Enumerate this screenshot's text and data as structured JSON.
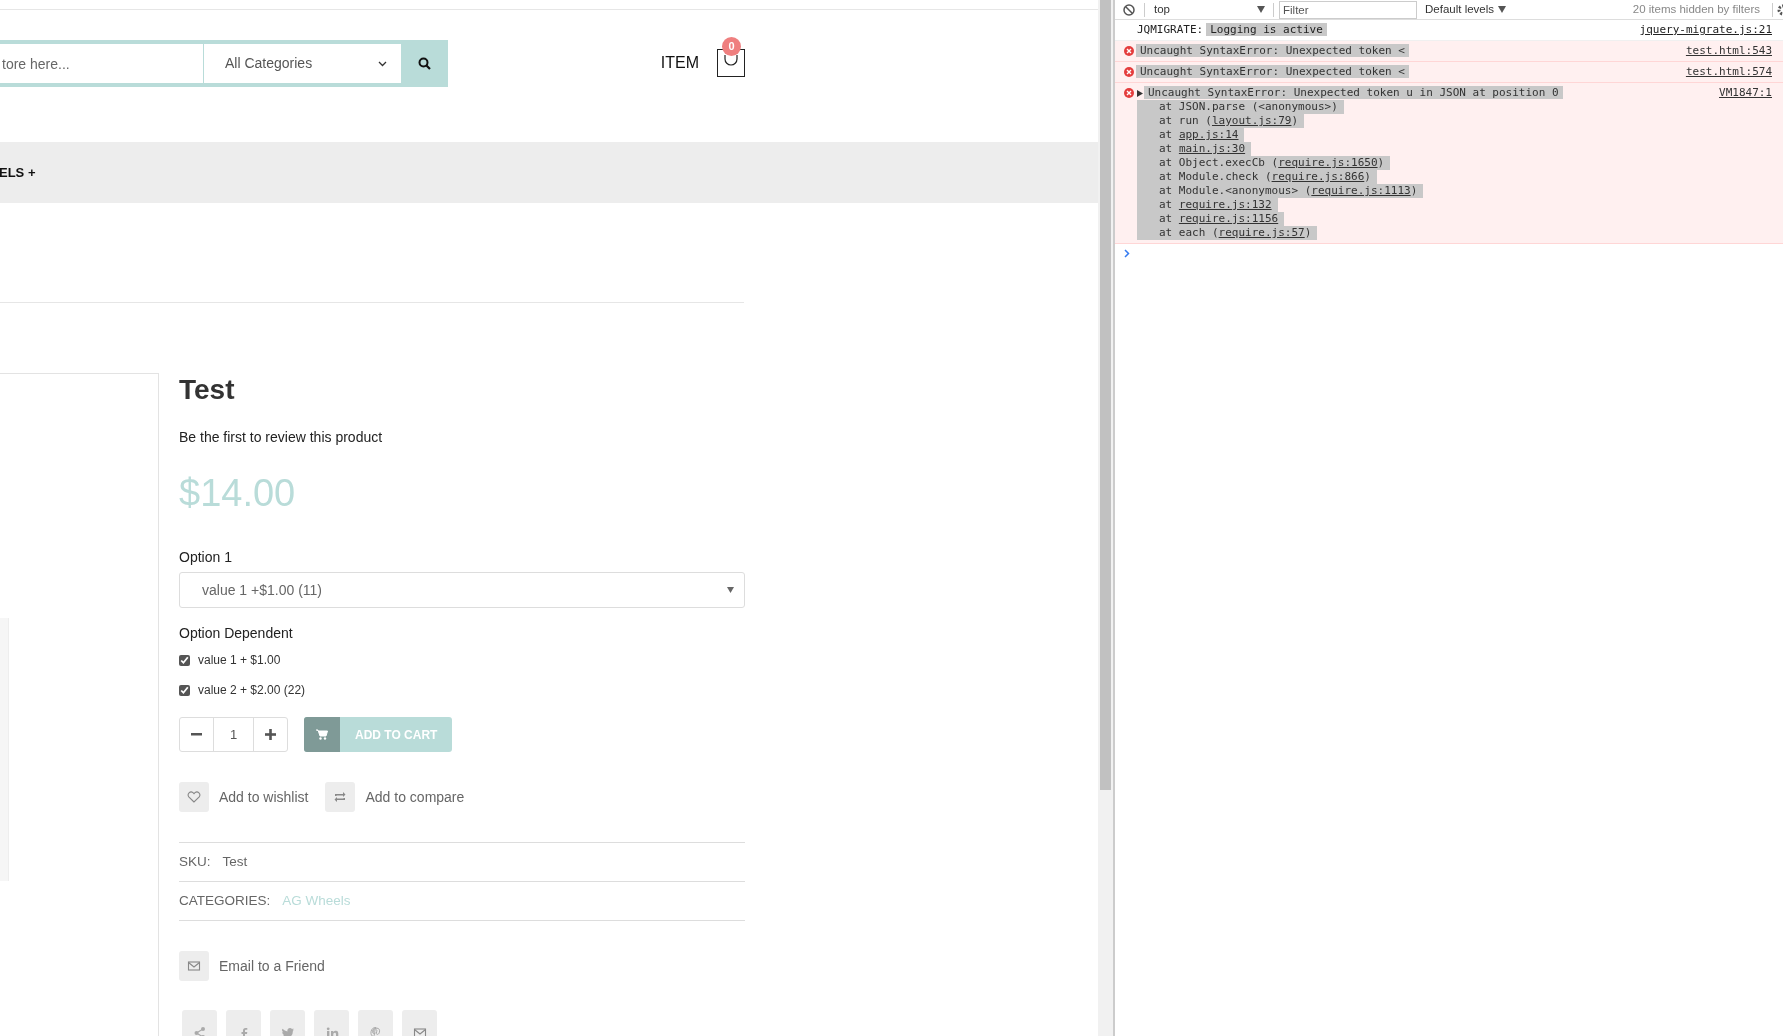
{
  "header": {
    "search": {
      "placeholder": "tore here..."
    },
    "category": "All Categories",
    "cart_label": "ITEM",
    "cart_count": "0"
  },
  "nav": {
    "item": "ELS +"
  },
  "product": {
    "title": "Test",
    "review_link": "Be the first to review this product",
    "price": "$14.00",
    "options": [
      {
        "kind": "select",
        "label": "Option 1",
        "value": "value 1 +$1.00 (11)"
      },
      {
        "kind": "checkboxes",
        "label": "Option Dependent",
        "items": [
          {
            "label": "value 1 + $1.00",
            "checked": true
          },
          {
            "label": "value 2 + $2.00 (22)",
            "checked": true
          }
        ]
      }
    ],
    "quantity": "1",
    "add_to_cart": "ADD TO CART",
    "actions": [
      {
        "kind": "wishlist",
        "label": "Add to wishlist"
      },
      {
        "kind": "compare",
        "label": "Add to compare"
      }
    ],
    "sku": {
      "label": "SKU:",
      "value": "Test"
    },
    "categories": {
      "label": "CATEGORIES:",
      "value": "AG Wheels"
    },
    "email": "Email to a Friend",
    "share": [
      {
        "kind": "share"
      },
      {
        "kind": "facebook"
      },
      {
        "kind": "twitter"
      },
      {
        "kind": "linkedin"
      },
      {
        "kind": "pinterest"
      },
      {
        "kind": "mail"
      }
    ]
  },
  "console": {
    "toolbar": {
      "context": "top",
      "filter_placeholder": "Filter",
      "levels": "Default levels",
      "hidden": "20 items hidden by filters"
    },
    "messages": [
      {
        "kind": "info",
        "prefix": "JQMIGRATE:",
        "text": "Logging is active",
        "source": "jquery-migrate.js:21"
      },
      {
        "kind": "error",
        "text": "Uncaught SyntaxError: Unexpected token <",
        "source": "test.html:543"
      },
      {
        "kind": "error",
        "text": "Uncaught SyntaxError: Unexpected token <",
        "source": "test.html:574"
      },
      {
        "kind": "error",
        "expanded": false,
        "text": "Uncaught SyntaxError: Unexpected token u in JSON at position 0",
        "source": "VM1847:1",
        "stack": [
          {
            "before": "at JSON.parse (<anonymous>)"
          },
          {
            "before": "at run (",
            "link": "layout.js:79",
            "after": ")"
          },
          {
            "before": "at ",
            "link": "app.js:14"
          },
          {
            "before": "at ",
            "link": "main.js:30"
          },
          {
            "before": "at Object.execCb (",
            "link": "require.js:1650",
            "after": ")"
          },
          {
            "before": "at Module.check (",
            "link": "require.js:866",
            "after": ")"
          },
          {
            "before": "at Module.<anonymous> (",
            "link": "require.js:1113",
            "after": ")"
          },
          {
            "before": "at ",
            "link": "require.js:132"
          },
          {
            "before": "at ",
            "link": "require.js:1156"
          },
          {
            "before": "at each (",
            "link": "require.js:57",
            "after": ")"
          }
        ]
      }
    ]
  }
}
